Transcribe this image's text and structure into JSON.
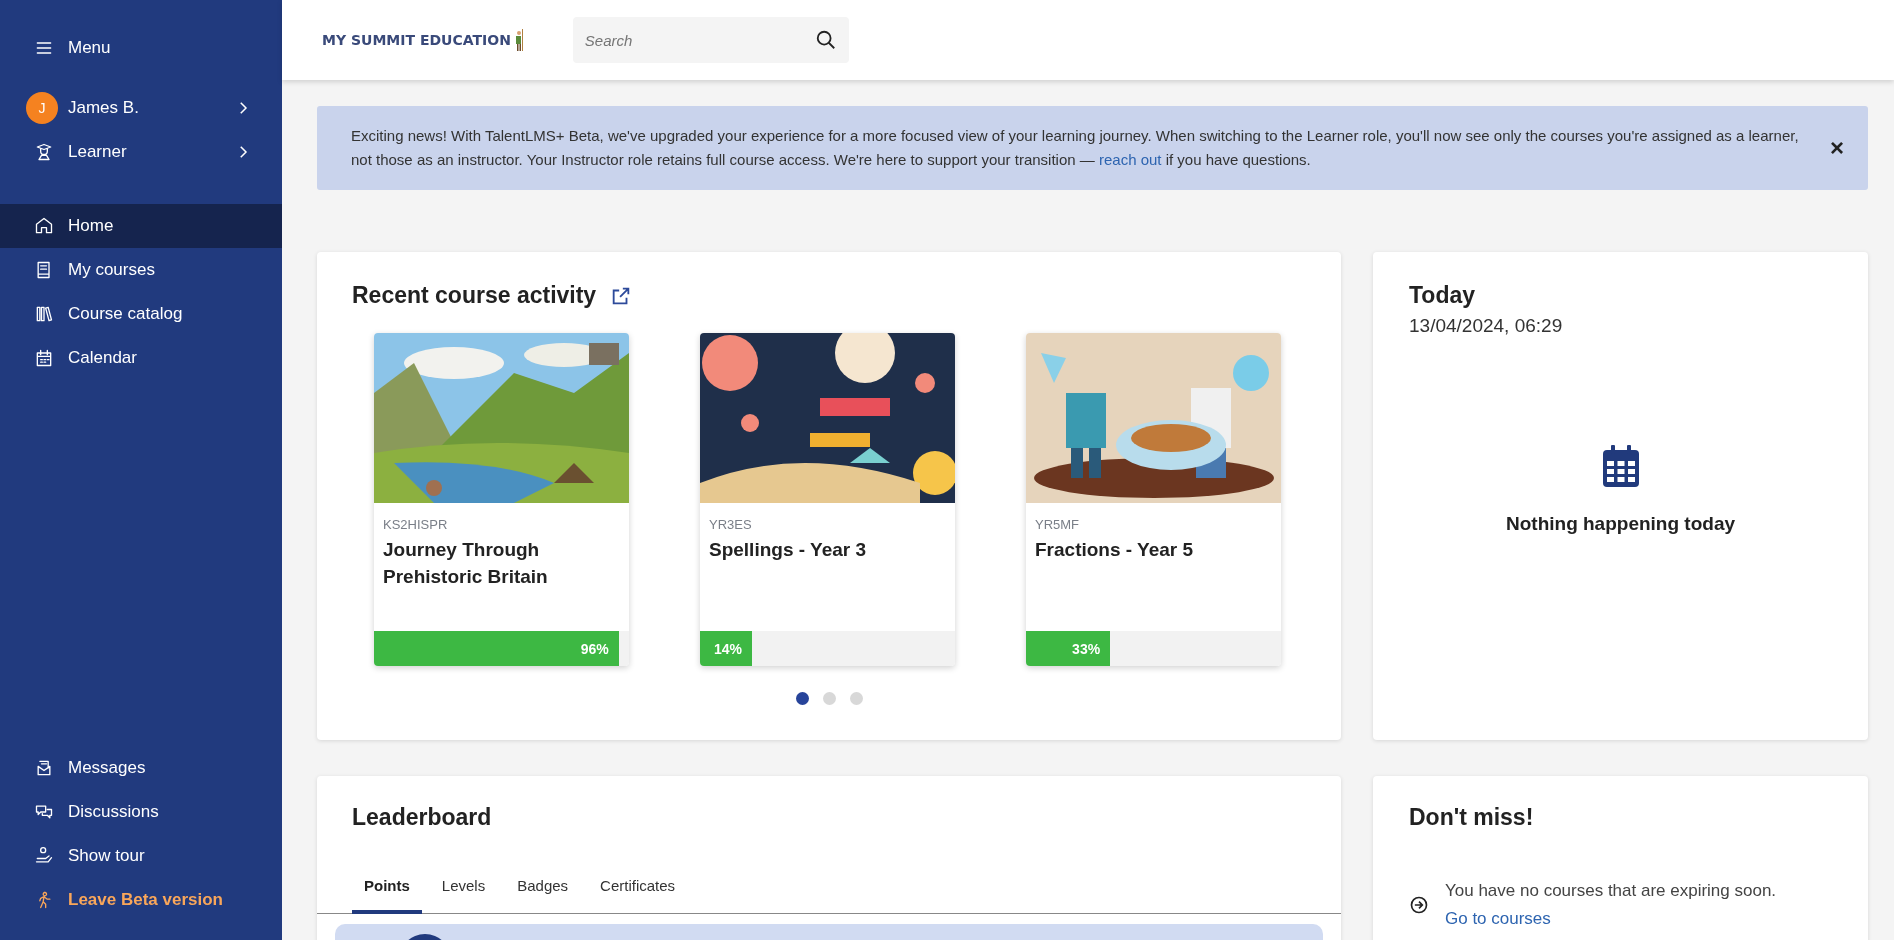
{
  "sidebar": {
    "menu_label": "Menu",
    "user": {
      "initial": "J",
      "name": "James B."
    },
    "role": {
      "label": "Learner"
    },
    "nav": [
      {
        "label": "Home",
        "selected": true
      },
      {
        "label": "My courses",
        "selected": false
      },
      {
        "label": "Course catalog",
        "selected": false
      },
      {
        "label": "Calendar",
        "selected": false
      }
    ],
    "footer": [
      {
        "label": "Messages",
        "kind": "item"
      },
      {
        "label": "Discussions",
        "kind": "item"
      },
      {
        "label": "Show tour",
        "kind": "item"
      },
      {
        "label": "Leave Beta version",
        "kind": "accent"
      }
    ]
  },
  "header": {
    "logo": "MY SUMMIT EDUCATION",
    "search": {
      "placeholder": "Search"
    }
  },
  "banner": {
    "text_before": "Exciting news! With TalentLMS+ Beta, we've upgraded your experience for a more focused view of your learning journey. When switching to the Learner role, you'll now see only the courses you're assigned as a learner, not those as an instructor. Your Instructor role retains full course access. We're here to support your transition — ",
    "link": "reach out",
    "text_after": " if you have questions.",
    "close": "×"
  },
  "recent": {
    "title": "Recent course activity",
    "courses": [
      {
        "code": "KS2HISPR",
        "title": "Journey Through Prehistoric Britain",
        "level": 0.96,
        "reading": "96%"
      },
      {
        "code": "YR3ES",
        "title": "Spellings - Year 3",
        "level": 0.14,
        "reading": "14%"
      },
      {
        "code": "YR5MF",
        "title": "Fractions - Year 5",
        "level": 0.33,
        "reading": "33%"
      }
    ],
    "dots": [
      {
        "selected": true
      },
      {
        "selected": false
      },
      {
        "selected": false
      }
    ]
  },
  "today": {
    "title": "Today",
    "datetime": "13/04/2024, 06:29",
    "empty": "Nothing happening today"
  },
  "leaderboard": {
    "title": "Leaderboard",
    "tabs": [
      {
        "label": "Points",
        "selected": true
      },
      {
        "label": "Levels",
        "selected": false
      },
      {
        "label": "Badges",
        "selected": false
      },
      {
        "label": "Certificates",
        "selected": false
      }
    ]
  },
  "dont_miss": {
    "title": "Don't miss!",
    "message": "You have no courses that are expiring soon. ",
    "link": "Go to courses"
  }
}
